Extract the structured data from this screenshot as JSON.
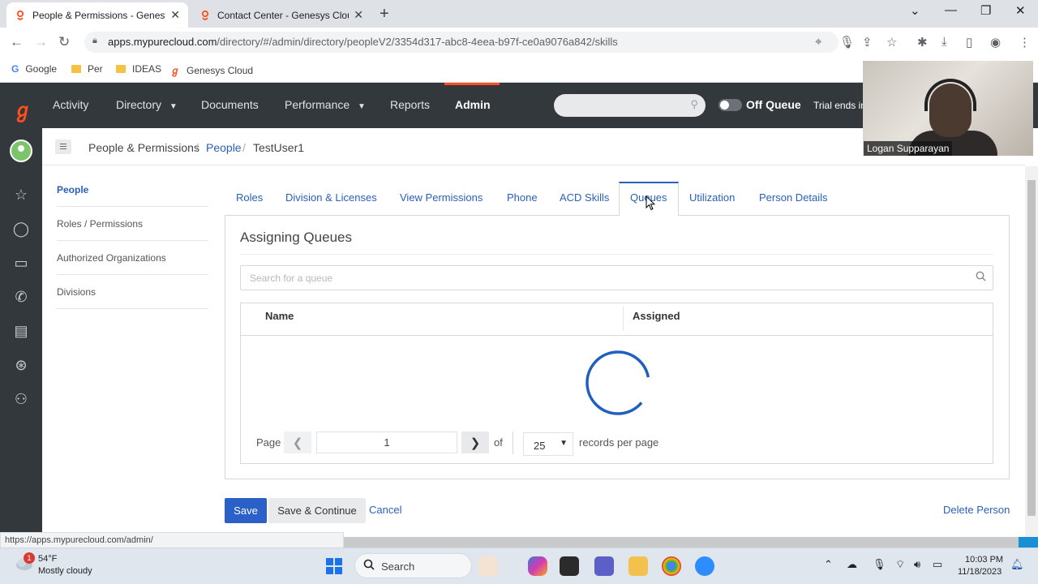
{
  "browser": {
    "tabs": [
      {
        "title": "People & Permissions - Genesys",
        "active": true
      },
      {
        "title": "Contact Center - Genesys Cloud",
        "active": false
      }
    ],
    "url_host": "apps.mypurecloud.com",
    "url_path": "/directory/#/admin/directory/peopleV2/3354d317-abc8-4eea-b97f-ce0a9076a842/skills",
    "bookmarks": [
      "Google",
      "Per",
      "IDEAS",
      "Genesys Cloud"
    ],
    "status_url": "https://apps.mypurecloud.com/admin/"
  },
  "app": {
    "nav": [
      "Activity",
      "Directory",
      "Documents",
      "Performance",
      "Reports",
      "Admin"
    ],
    "status_label": "Off Queue",
    "trial_text": "Trial ends in"
  },
  "breadcrumb": {
    "root": "People & Permissions",
    "section": "People",
    "current": "TestUser1"
  },
  "subnav": [
    "People",
    "Roles / Permissions",
    "Authorized Organizations",
    "Divisions"
  ],
  "tabs": [
    "Roles",
    "Division & Licenses",
    "View Permissions",
    "Phone",
    "ACD Skills",
    "Queues",
    "Utilization",
    "Person Details"
  ],
  "active_tab": "Queues",
  "panel": {
    "title": "Assigning Queues",
    "search_placeholder": "Search for a queue",
    "columns": [
      "Name",
      "Assigned"
    ],
    "loading": true
  },
  "pagination": {
    "page_label": "Page",
    "page_value": "1",
    "of_label": "of",
    "per_page": "25",
    "per_page_label": "records per page"
  },
  "actions": {
    "save": "Save",
    "save_continue": "Save & Continue",
    "cancel": "Cancel",
    "delete": "Delete Person"
  },
  "video": {
    "participant": "Logan Supparayan"
  },
  "taskbar": {
    "weather_temp": "54°F",
    "weather_desc": "Mostly cloudy",
    "weather_badge": "1",
    "search_label": "Search",
    "time": "10:03 PM",
    "date": "11/18/2023"
  },
  "colors": {
    "brand_orange": "#ff4f1f",
    "link_blue": "#2a60b8",
    "primary_button": "#2a60c8",
    "app_header": "#33383d"
  },
  "icons": {
    "rail": [
      "star-icon",
      "chat-icon",
      "video-icon",
      "phone-icon",
      "inbox-icon",
      "lifebuoy-icon",
      "contacts-icon"
    ]
  }
}
